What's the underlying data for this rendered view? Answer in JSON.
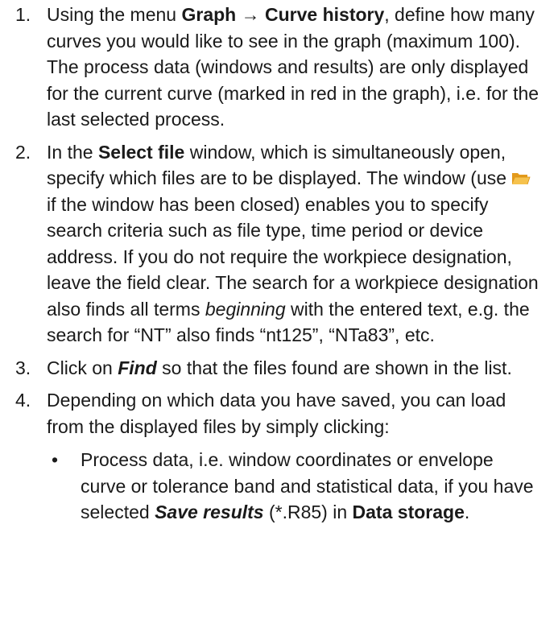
{
  "steps": [
    {
      "num": "1.",
      "t1": "Using the menu ",
      "menu_graph": "Graph",
      "arrow": " → ",
      "menu_history": "Curve history",
      "t2": ", define how many curves you would like to see in the graph (max­imum 100). The process data (windows and results) are only displayed for the current curve (marked in red in the graph), i.e. for the last selected process."
    },
    {
      "num": "2.",
      "t1": "In the ",
      "select_file": "Select file",
      "t2": " window, which is simultaneously open, specify which files are to be displayed. The window (use ",
      "t3": "if the window has been closed) enables you to specify search criteria such as file type, time period or device address. If you do not require the workpiece designation, leave the field clear. The search for a workpiece designation also finds all terms ",
      "beginning": "beginning",
      "t4": " with the entered text, e.g. the search for “NT” also finds “nt125”, “NTa83”, etc.",
      "icon": "open-folder-icon"
    },
    {
      "num": "3.",
      "t1": "Click on ",
      "find": "Find",
      "t2": " so that the files found are shown in the list."
    },
    {
      "num": "4.",
      "t1": "Depending on which data you have saved, you can load from the displayed files by simply clicking:"
    }
  ],
  "bullet": {
    "symbol": "•",
    "t1": "Process data, i.e. window coordinates or envelope curve or tolerance band and statistical data, if you have selected ",
    "save_results": "Save results",
    "t2": " (*.R85) in ",
    "data_storage": "Data storage",
    "t3": "."
  },
  "colors": {
    "text": "#1a1a1a",
    "folder": "#f2b33d"
  }
}
